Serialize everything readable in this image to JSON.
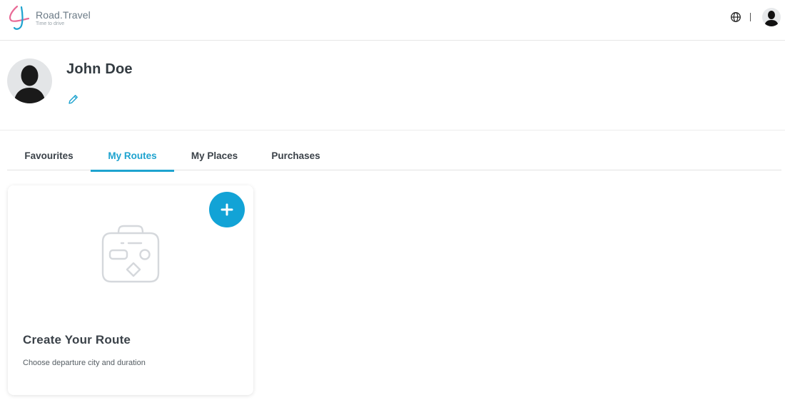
{
  "brand": {
    "name": "Road.Travel",
    "tagline": "Time to drive",
    "colors": {
      "pink": "#e96a96",
      "blue": "#1ea3cf",
      "accent": "#12a3d6"
    }
  },
  "header": {
    "icons": [
      "globe-icon",
      "avatar"
    ]
  },
  "profile": {
    "name": "John Doe",
    "edit_icon": "pencil-icon"
  },
  "tabs": [
    {
      "label": "Favourites",
      "active": false
    },
    {
      "label": "My Routes",
      "active": true
    },
    {
      "label": "My Places",
      "active": false
    },
    {
      "label": "Purchases",
      "active": false
    }
  ],
  "route_card": {
    "title": "Create Your Route",
    "subtitle": "Choose departure city and duration",
    "add_icon": "plus-icon",
    "illustration": "suitcase-icon"
  }
}
